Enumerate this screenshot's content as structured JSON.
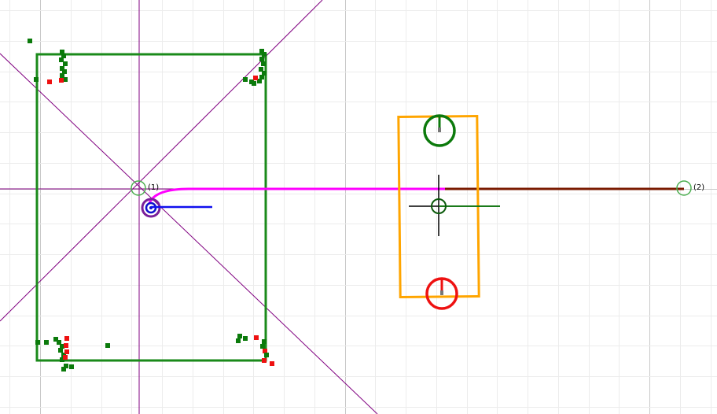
{
  "canvas": {
    "background": "#ffffff",
    "minor_grid_color": "#ececec",
    "major_grid_color": "#c8c8c8",
    "construction_line_color": "#800080"
  },
  "markers": [
    {
      "id": "1",
      "label": "(1)",
      "color": "#4caf50"
    },
    {
      "id": "2",
      "label": "(2)",
      "color": "#4caf50"
    }
  ],
  "colors": {
    "board_outline": "#1a8a1a",
    "scan_points_green": "#0b7a0b",
    "scan_points_red": "#ee1111",
    "robot_ring": "#7a1f9a",
    "robot_core": "#1010cc",
    "robot_heading": "#1010ee",
    "path": "#ff00ff",
    "path_segment": "#7a1a00",
    "target_box": "#ffa500",
    "goal_green": "#0c7a0c",
    "goal_red": "#ee1111",
    "crosshair": "#000000",
    "center_ring": "#0b5a0b"
  }
}
